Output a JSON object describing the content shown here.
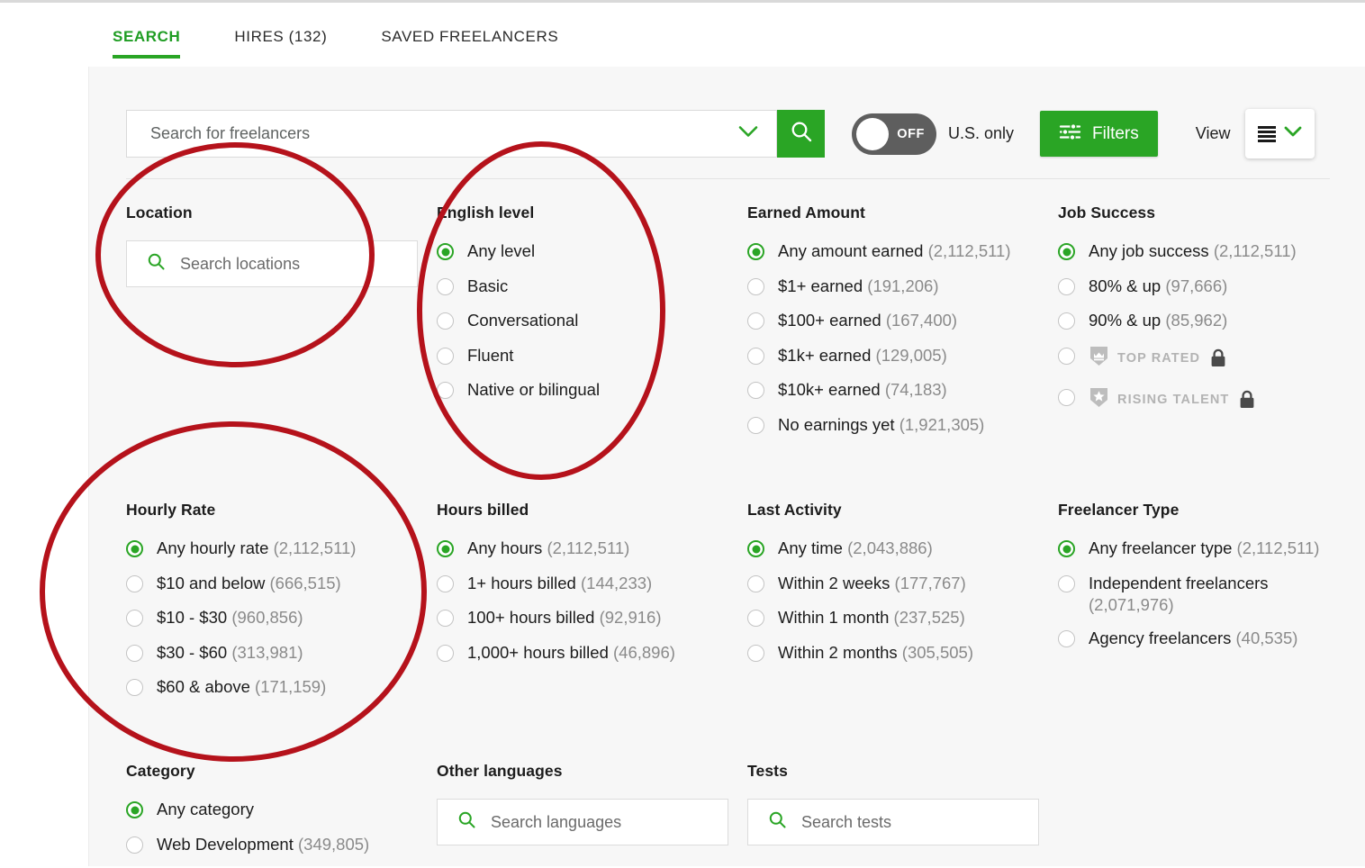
{
  "tabs": [
    {
      "label": "SEARCH",
      "active": true
    },
    {
      "label": "HIRES (132)",
      "active": false
    },
    {
      "label": "SAVED FREELANCERS",
      "active": false
    }
  ],
  "toolbar": {
    "search_placeholder": "Search for freelancers",
    "search_value": "",
    "toggle_state": "OFF",
    "us_only_label": "U.S. only",
    "filters_label": "Filters",
    "view_label": "View"
  },
  "colors": {
    "accent_green": "#2aa525",
    "panel_bg": "#f7f7f7",
    "annotation_red": "#b5121b",
    "muted_text": "#8a8a8a"
  },
  "filters": {
    "location": {
      "title": "Location",
      "input_placeholder": "Search locations"
    },
    "english_level": {
      "title": "English level",
      "options": [
        {
          "label": "Any level",
          "count": "",
          "selected": true
        },
        {
          "label": "Basic",
          "count": "",
          "selected": false
        },
        {
          "label": "Conversational",
          "count": "",
          "selected": false
        },
        {
          "label": "Fluent",
          "count": "",
          "selected": false
        },
        {
          "label": "Native or bilingual",
          "count": "",
          "selected": false
        }
      ]
    },
    "earned_amount": {
      "title": "Earned Amount",
      "options": [
        {
          "label": "Any amount earned",
          "count": "(2,112,511)",
          "selected": true
        },
        {
          "label": "$1+ earned",
          "count": "(191,206)",
          "selected": false
        },
        {
          "label": "$100+ earned",
          "count": "(167,400)",
          "selected": false
        },
        {
          "label": "$1k+ earned",
          "count": "(129,005)",
          "selected": false
        },
        {
          "label": "$10k+ earned",
          "count": "(74,183)",
          "selected": false
        },
        {
          "label": "No earnings yet",
          "count": "(1,921,305)",
          "selected": false
        }
      ]
    },
    "job_success": {
      "title": "Job Success",
      "options": [
        {
          "label": "Any job success",
          "count": "(2,112,511)",
          "selected": true
        },
        {
          "label": "80% & up",
          "count": "(97,666)",
          "selected": false
        },
        {
          "label": "90% & up",
          "count": "(85,962)",
          "selected": false
        }
      ],
      "locked_options": [
        {
          "label": "TOP RATED",
          "icon": "crown-shield-icon",
          "locked": true
        },
        {
          "label": "RISING TALENT",
          "icon": "star-shield-icon",
          "locked": true
        }
      ]
    },
    "hourly_rate": {
      "title": "Hourly Rate",
      "options": [
        {
          "label": "Any hourly rate",
          "count": "(2,112,511)",
          "selected": true
        },
        {
          "label": "$10 and below",
          "count": "(666,515)",
          "selected": false
        },
        {
          "label": "$10 - $30",
          "count": "(960,856)",
          "selected": false
        },
        {
          "label": "$30 - $60",
          "count": "(313,981)",
          "selected": false
        },
        {
          "label": "$60 & above",
          "count": "(171,159)",
          "selected": false
        }
      ]
    },
    "hours_billed": {
      "title": "Hours billed",
      "options": [
        {
          "label": "Any hours",
          "count": "(2,112,511)",
          "selected": true
        },
        {
          "label": "1+ hours billed",
          "count": "(144,233)",
          "selected": false
        },
        {
          "label": "100+ hours billed",
          "count": "(92,916)",
          "selected": false
        },
        {
          "label": "1,000+ hours billed",
          "count": "(46,896)",
          "selected": false
        }
      ]
    },
    "last_activity": {
      "title": "Last Activity",
      "options": [
        {
          "label": "Any time",
          "count": "(2,043,886)",
          "selected": true
        },
        {
          "label": "Within 2 weeks",
          "count": "(177,767)",
          "selected": false
        },
        {
          "label": "Within 1 month",
          "count": "(237,525)",
          "selected": false
        },
        {
          "label": "Within 2 months",
          "count": "(305,505)",
          "selected": false
        }
      ]
    },
    "freelancer_type": {
      "title": "Freelancer Type",
      "options": [
        {
          "label": "Any freelancer type",
          "count": "(2,112,511)",
          "selected": true
        },
        {
          "label": "Independent freelancers",
          "count": "(2,071,976)",
          "selected": false
        },
        {
          "label": "Agency freelancers",
          "count": "(40,535)",
          "selected": false
        }
      ]
    },
    "category": {
      "title": "Category",
      "options": [
        {
          "label": "Any category",
          "count": "",
          "selected": true
        },
        {
          "label": "Web Development",
          "count": "(349,805)",
          "selected": false
        }
      ]
    },
    "other_languages": {
      "title": "Other languages",
      "input_placeholder": "Search languages"
    },
    "tests": {
      "title": "Tests",
      "input_placeholder": "Search tests"
    }
  }
}
